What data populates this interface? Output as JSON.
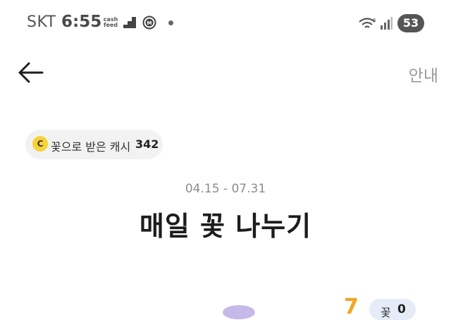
{
  "status_bar": {
    "carrier": "SKT",
    "time": "6:55",
    "cashfeed_line1": "cash",
    "cashfeed_line2": "feed",
    "battery": "53",
    "icons": [
      "stairs-icon",
      "m-circle-icon",
      "dot-icon",
      "wifi-icon",
      "signal-icon",
      "battery-icon"
    ]
  },
  "header": {
    "back_icon": "arrow-left-icon",
    "guide_label": "안내"
  },
  "cash_chip": {
    "coin_letter": "C",
    "label": "꽃으로 받은 캐시",
    "value": "342"
  },
  "event": {
    "period": "04.15 - 07.31",
    "title": "매일 꽃 나누기"
  },
  "bottom": {
    "number_badge": "7",
    "flower_pill_label": "꽃",
    "flower_pill_count": "0"
  },
  "colors": {
    "coin": "#f7d238",
    "badge": "#f0a623",
    "chip_bg": "#f2f2f2",
    "pill_bg": "#e6ecf7"
  }
}
